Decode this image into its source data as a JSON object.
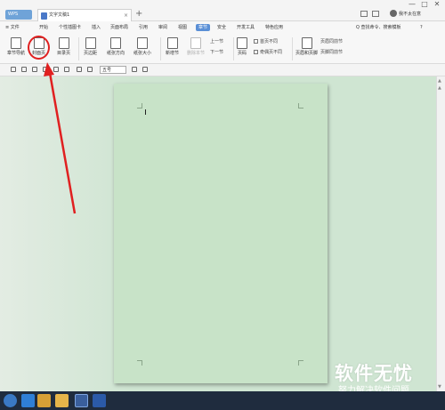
{
  "titlebar": {
    "app_tab": "WPS",
    "doc_tab": "文字文稿1",
    "new_tab": "+",
    "close_tab": "×",
    "user": "我不太在意",
    "window_controls": [
      "—",
      "□",
      "✕"
    ]
  },
  "menubar": {
    "file": "≡ 文件",
    "items": [
      "开始",
      "个性插图卡",
      "插入",
      "页面布局",
      "引用",
      "审阅",
      "视图",
      "章节",
      "安全",
      "开发工具",
      "特色应用"
    ],
    "active_index": 7,
    "search": "Q 查找命令、搜索模板",
    "help": "?"
  },
  "ribbon": {
    "chapter_nav": "章节导航",
    "cover": "封面页",
    "contents": "目录页",
    "header_footer": "页边距",
    "orientation": "纸张方向",
    "size": "纸张大小",
    "new_section": "新增节",
    "delete_section": "删除本节",
    "merge": "拆分",
    "prev_section": "上一节",
    "next_section": "下一节",
    "page_number": "页码",
    "first_diff": "首页不同",
    "odd_even_diff": "奇偶页不同",
    "header_footer_btn": "页眉和页脚",
    "link_prev_header": "页眉同前节",
    "link_prev_footer": "页脚同前节"
  },
  "quickbar": {
    "font_size": "五号"
  },
  "watermark": {
    "main": "软件无忧",
    "sub": "努力解决软件问题"
  },
  "colors": {
    "accent": "#5a8fd6",
    "page": "#c8e3c8",
    "workspace": "#cfe5d2",
    "annotation": "#e02020",
    "taskbar": "#1f2c3e"
  }
}
